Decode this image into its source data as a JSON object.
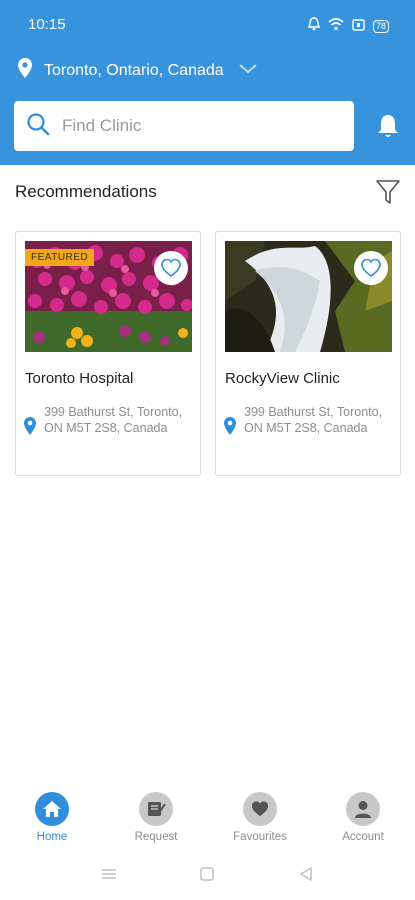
{
  "status": {
    "time": "10:15",
    "battery": "78"
  },
  "location": {
    "label": "Toronto, Ontario, Canada"
  },
  "search": {
    "placeholder": "Find Clinic"
  },
  "section": {
    "title": "Recommendations"
  },
  "clinics": [
    {
      "name": "Toronto Hospital",
      "badge": "FEATURED",
      "address": "399 Bathurst St, Toronto, ON M5T 2S8, Canada"
    },
    {
      "name": "RockyView Clinic",
      "address": "399 Bathurst St, Toronto, ON M5T 2S8, Canada"
    }
  ],
  "nav": [
    {
      "label": "Home",
      "icon": "home-icon",
      "active": true
    },
    {
      "label": "Request",
      "icon": "request-icon"
    },
    {
      "label": "Favourites",
      "icon": "heart-icon"
    },
    {
      "label": "Account",
      "icon": "account-icon"
    }
  ],
  "colors": {
    "primary": "#3794dc",
    "featured": "#f0a81a",
    "inactive": "#c8c8c8"
  }
}
